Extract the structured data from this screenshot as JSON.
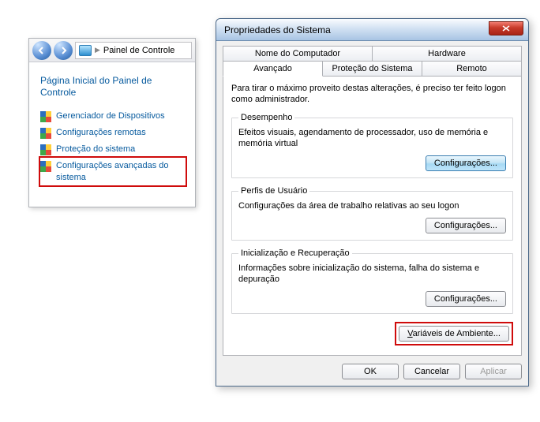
{
  "cp": {
    "breadcrumb": "Painel de Controle",
    "home": "Página Inicial do Painel de Controle",
    "items": [
      {
        "label": "Gerenciador de Dispositivos",
        "highlight": false
      },
      {
        "label": "Configurações remotas",
        "highlight": false
      },
      {
        "label": "Proteção do sistema",
        "highlight": false
      },
      {
        "label": "Configurações avançadas do sistema",
        "highlight": true
      }
    ]
  },
  "dlg": {
    "title": "Propriedades do Sistema",
    "tabs": {
      "row1": [
        "Nome do Computador",
        "Hardware"
      ],
      "row2": [
        "Avançado",
        "Proteção do Sistema",
        "Remoto"
      ],
      "active": "Avançado"
    },
    "note": "Para tirar o máximo proveito destas alterações, é preciso ter feito logon como administrador.",
    "groups": {
      "perf": {
        "legend": "Desempenho",
        "desc": "Efeitos visuais, agendamento de processador, uso de memória e memória virtual",
        "button": "Configurações..."
      },
      "profiles": {
        "legend": "Perfis de Usuário",
        "desc": "Configurações da área de trabalho relativas ao seu logon",
        "button": "Configurações..."
      },
      "startup": {
        "legend": "Inicialização e Recuperação",
        "desc": "Informações sobre inicialização do sistema, falha do sistema e depuração",
        "button": "Configurações..."
      }
    },
    "env_button_prefix": "V",
    "env_button_rest": "ariáveis de Ambiente...",
    "footer": {
      "ok": "OK",
      "cancel": "Cancelar",
      "apply": "Aplicar"
    }
  }
}
